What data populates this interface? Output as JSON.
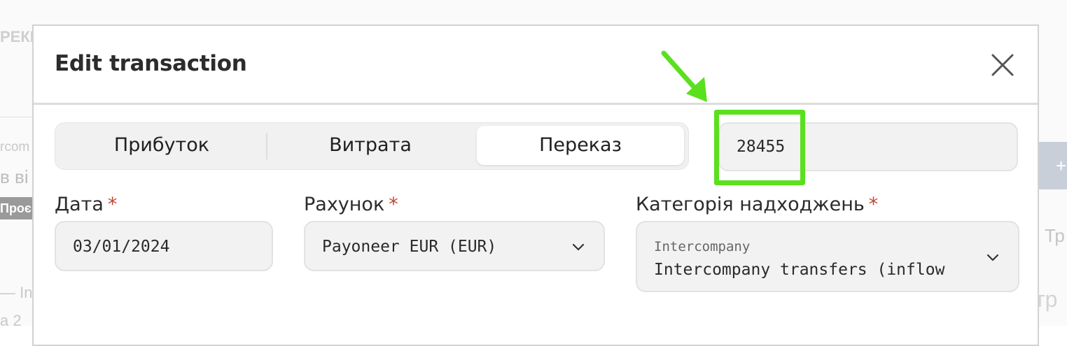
{
  "background": {
    "fragment_top": "РЕКЕ",
    "fragment_left_1": "rcom",
    "fragment_left_2": "в ві",
    "fragment_badge": "Проєк",
    "fragment_left_3": "— In",
    "fragment_left_4": "а 2",
    "fragment_right_1": "Тр",
    "fragment_right_2": "тр",
    "plus_button": "+"
  },
  "modal": {
    "title": "Edit transaction",
    "close_icon": "close-icon"
  },
  "type_tabs": {
    "options": [
      "Прибуток",
      "Витрата",
      "Переказ"
    ],
    "selected": "Переказ"
  },
  "amount": {
    "value": "28455"
  },
  "fields": {
    "date": {
      "label": "Дата",
      "required_mark": "*",
      "value": "03/01/2024"
    },
    "account": {
      "label": "Рахунок",
      "required_mark": "*",
      "value": "Payoneer EUR (EUR)"
    },
    "category": {
      "label": "Категорія надходжень",
      "required_mark": "*",
      "group": "Intercompany",
      "value": "Intercompany transfers (inflow"
    }
  },
  "colors": {
    "highlight": "#5ae01d",
    "required": "#c0473a"
  }
}
